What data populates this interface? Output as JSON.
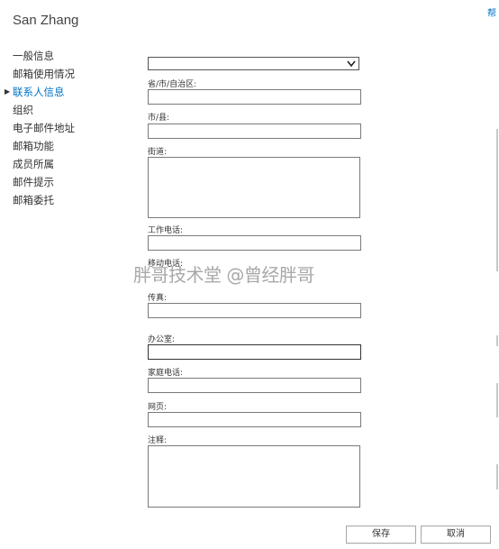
{
  "header": {
    "title": "San Zhang",
    "help_label": "帮"
  },
  "nav": {
    "items": [
      {
        "label": "一般信息",
        "active": false
      },
      {
        "label": "邮箱使用情况",
        "active": false
      },
      {
        "label": "联系人信息",
        "active": true
      },
      {
        "label": "组织",
        "active": false
      },
      {
        "label": "电子邮件地址",
        "active": false
      },
      {
        "label": "邮箱功能",
        "active": false
      },
      {
        "label": "成员所属",
        "active": false
      },
      {
        "label": "邮件提示",
        "active": false
      },
      {
        "label": "邮箱委托",
        "active": false
      }
    ]
  },
  "form": {
    "country_select_value": "",
    "province_label": "省/市/自治区:",
    "province_value": "",
    "city_label": "市/县:",
    "city_value": "",
    "street_label": "街道:",
    "street_value": "",
    "work_phone_label": "工作电话:",
    "work_phone_value": "",
    "mobile_label": "移动电话:",
    "fax_label": "传真:",
    "fax_value": "",
    "office_label": "办公室:",
    "office_value": "",
    "home_phone_label": "家庭电话:",
    "home_phone_value": "",
    "webpage_label": "网页:",
    "webpage_value": "",
    "notes_label": "注释:",
    "notes_value": ""
  },
  "footer": {
    "save_label": "保存",
    "cancel_label": "取消"
  },
  "watermark": {
    "text": "胖哥技术堂 @曾经胖哥"
  },
  "colors": {
    "accent": "#0072c6",
    "text": "#333333",
    "border": "#7a7a7a"
  }
}
